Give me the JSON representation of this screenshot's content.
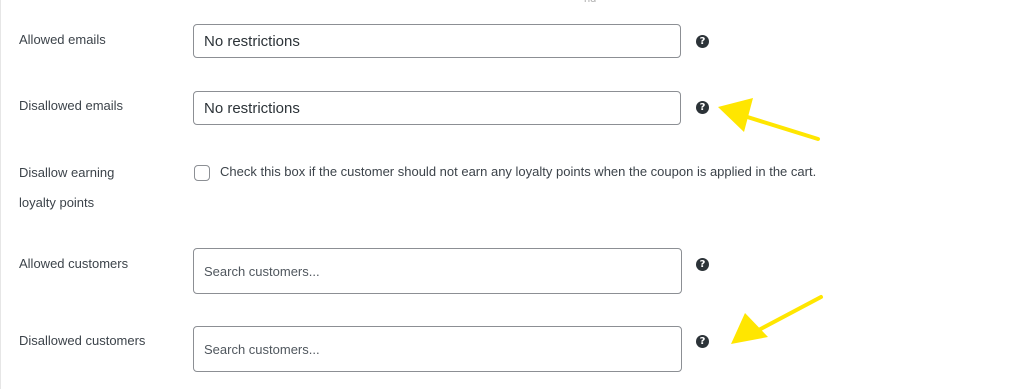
{
  "top_fragment": "nd",
  "rows": {
    "allowed_emails": {
      "label": "Allowed emails",
      "value": "No restrictions"
    },
    "disallowed_emails": {
      "label": "Disallowed emails",
      "value": "No restrictions"
    },
    "disallow_loyalty": {
      "label_line1": "Disallow earning",
      "label_line2": "loyalty points",
      "checked": false,
      "description": "Check this box if the customer should not earn any loyalty points when the coupon is applied in the cart."
    },
    "allowed_customers": {
      "label": "Allowed customers",
      "placeholder": "Search customers..."
    },
    "disallowed_customers": {
      "label": "Disallowed customers",
      "placeholder": "Search customers..."
    }
  },
  "help_icon_glyph": "?",
  "colors": {
    "annotation_arrow": "#ffe600",
    "help_icon_bg": "#2c3338",
    "input_border": "#8c8f94"
  }
}
